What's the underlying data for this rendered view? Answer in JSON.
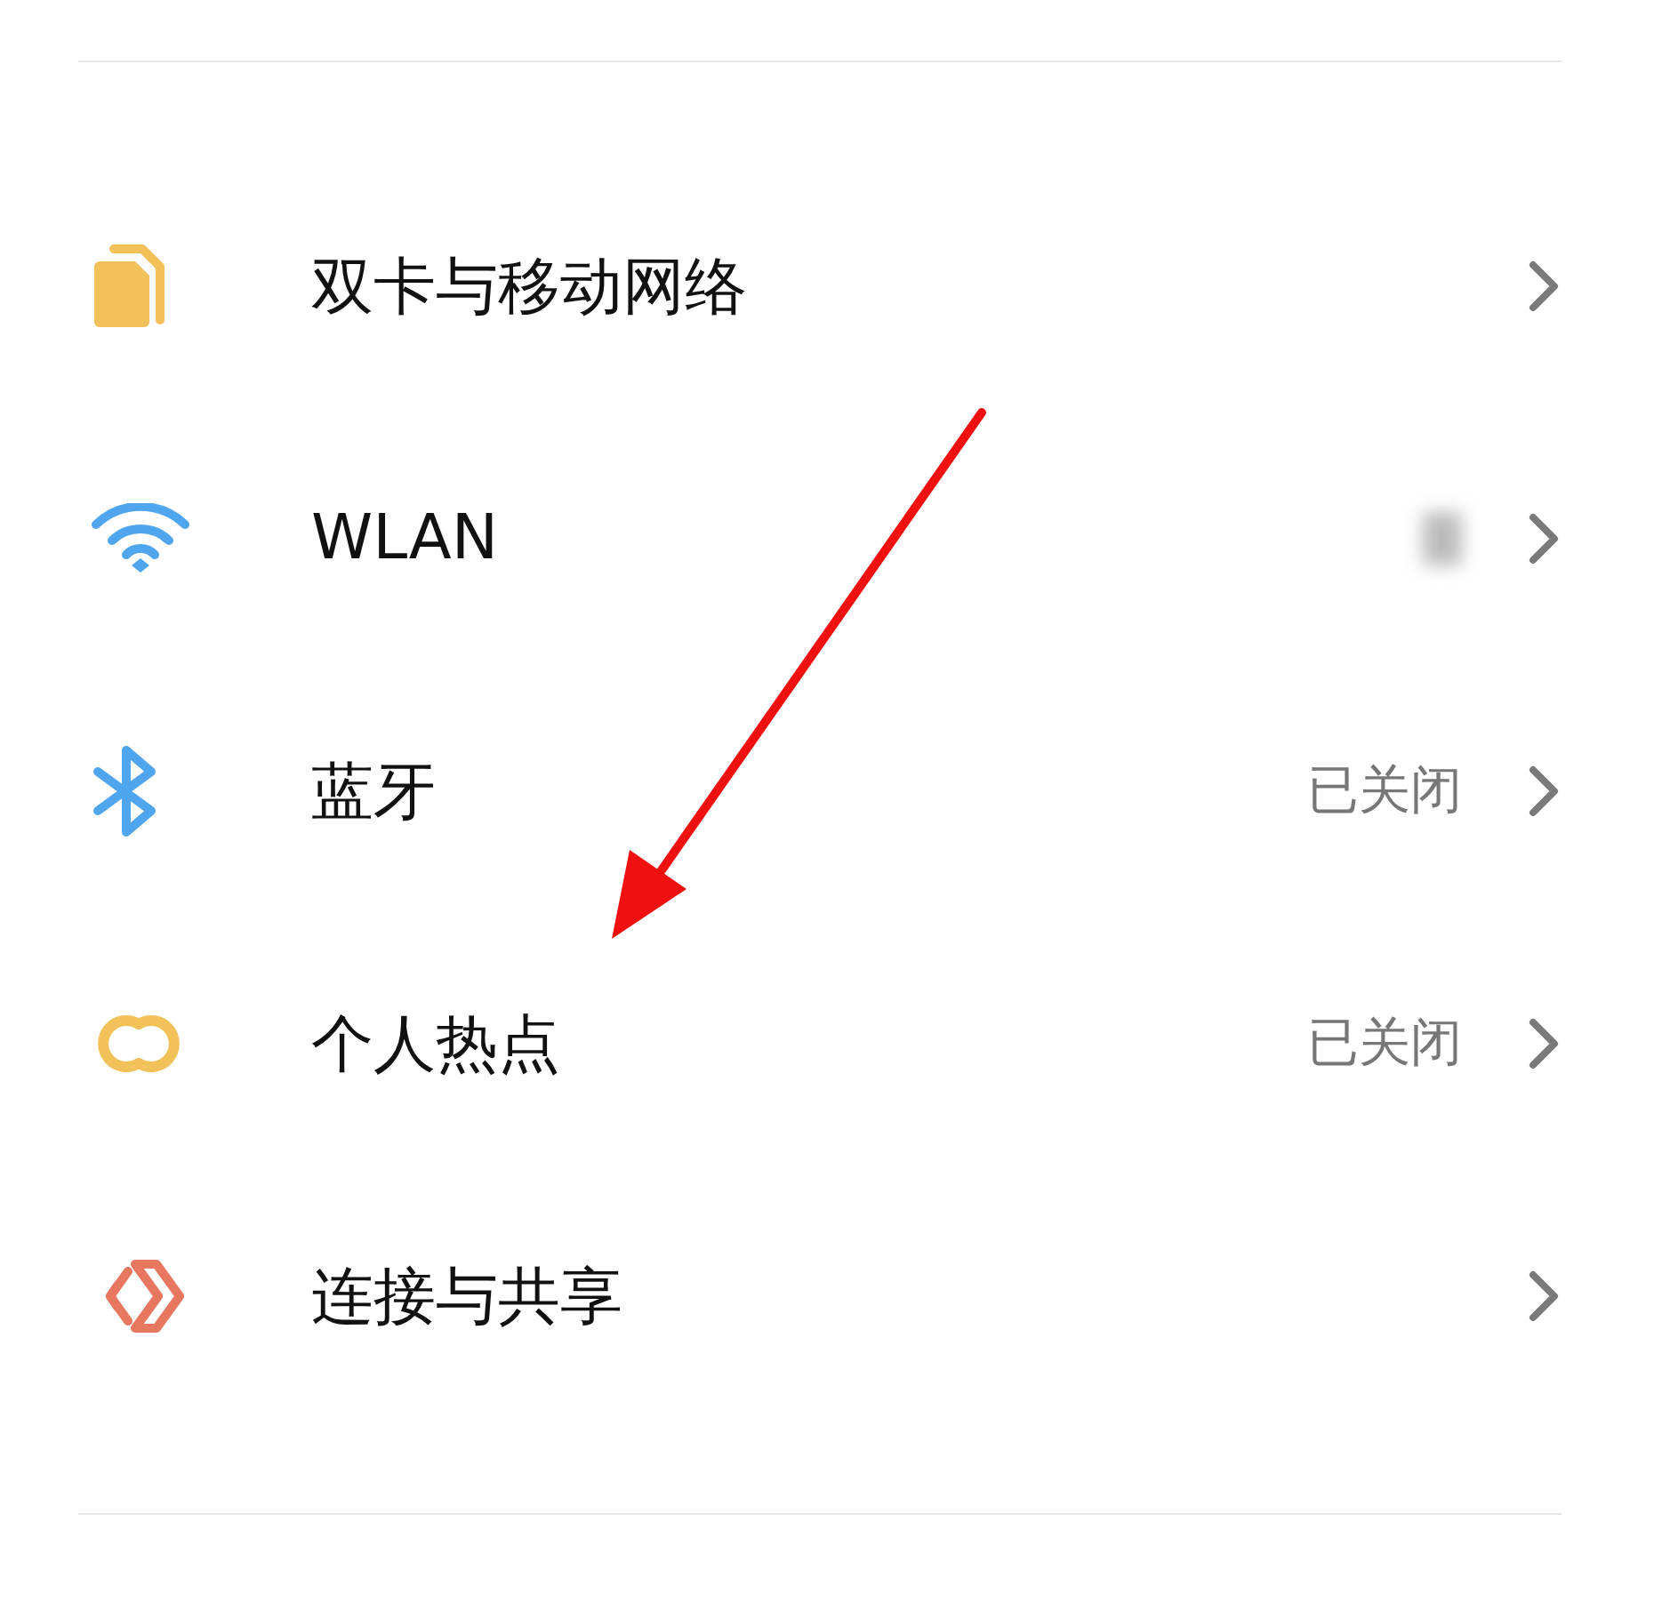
{
  "settings": [
    {
      "kind": "sim",
      "label": "双卡与移动网络"
    },
    {
      "kind": "wifi",
      "label": "WLAN",
      "redacted": true
    },
    {
      "kind": "bluetooth",
      "label": "蓝牙",
      "status": "已关闭"
    },
    {
      "kind": "hotspot",
      "label": "个人热点",
      "status": "已关闭"
    },
    {
      "kind": "share",
      "label": "连接与共享"
    }
  ]
}
